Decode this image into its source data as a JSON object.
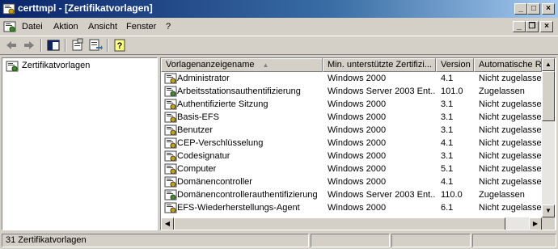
{
  "window": {
    "title": "certtmpl - [Zertifikatvorlagen]",
    "caption_buttons": {
      "minimize": "_",
      "maximize": "□",
      "close": "×"
    }
  },
  "menu": {
    "items": [
      {
        "label": "Datei"
      },
      {
        "label": "Aktion"
      },
      {
        "label": "Ansicht"
      },
      {
        "label": "Fenster"
      },
      {
        "label": "?"
      }
    ],
    "mdi_buttons": {
      "minimize": "_",
      "restore": "❐",
      "close": "×"
    }
  },
  "toolbar": {
    "icons": [
      "back-arrow-icon",
      "forward-arrow-icon",
      "show-hide-tree-icon",
      "properties-icon",
      "export-list-icon",
      "help-icon"
    ]
  },
  "tree": {
    "root_label": "Zertifikatvorlagen"
  },
  "list": {
    "columns": [
      {
        "label": "Vorlagenanzeigename",
        "sort": "▲"
      },
      {
        "label": "Min. unterstützte Zertifizi..."
      },
      {
        "label": "Version"
      },
      {
        "label": "Automatische R..."
      }
    ],
    "rows": [
      {
        "name": "Administrator",
        "min": "Windows 2000",
        "version": "4.1",
        "auto": "Nicht zugelassen",
        "icon_color": "#c8a000"
      },
      {
        "name": "Arbeitsstationsauthentifizierung",
        "min": "Windows Server 2003 Ent...",
        "version": "101.0",
        "auto": "Zugelassen",
        "icon_color": "#3a8a2a"
      },
      {
        "name": "Authentifizierte Sitzung",
        "min": "Windows 2000",
        "version": "3.1",
        "auto": "Nicht zugelassen",
        "icon_color": "#c8a000"
      },
      {
        "name": "Basis-EFS",
        "min": "Windows 2000",
        "version": "3.1",
        "auto": "Nicht zugelassen",
        "icon_color": "#c8a000"
      },
      {
        "name": "Benutzer",
        "min": "Windows 2000",
        "version": "3.1",
        "auto": "Nicht zugelassen",
        "icon_color": "#c8a000"
      },
      {
        "name": "CEP-Verschlüsselung",
        "min": "Windows 2000",
        "version": "4.1",
        "auto": "Nicht zugelassen",
        "icon_color": "#c8a000"
      },
      {
        "name": "Codesignatur",
        "min": "Windows 2000",
        "version": "3.1",
        "auto": "Nicht zugelassen",
        "icon_color": "#c8a000"
      },
      {
        "name": "Computer",
        "min": "Windows 2000",
        "version": "5.1",
        "auto": "Nicht zugelassen",
        "icon_color": "#c8a000"
      },
      {
        "name": "Domänencontroller",
        "min": "Windows 2000",
        "version": "4.1",
        "auto": "Nicht zugelassen",
        "icon_color": "#c8a000"
      },
      {
        "name": "Domänencontrollerauthentifizierung",
        "min": "Windows Server 2003 Ent...",
        "version": "110.0",
        "auto": "Zugelassen",
        "icon_color": "#3a8a2a"
      },
      {
        "name": "EFS-Wiederherstellungs-Agent",
        "min": "Windows 2000",
        "version": "6.1",
        "auto": "Nicht zugelassen",
        "icon_color": "#c8a000"
      }
    ]
  },
  "status": {
    "text": "31 Zertifikatvorlagen"
  }
}
